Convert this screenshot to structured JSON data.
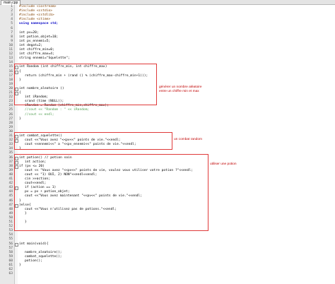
{
  "tab": {
    "label": "main.cpp"
  },
  "lines": [
    {
      "n": "1",
      "text": "#include <iostream>",
      "cls": "pp",
      "indent": 0
    },
    {
      "n": "2",
      "text": "#include <cstdio>",
      "cls": "pp",
      "indent": 0
    },
    {
      "n": "3",
      "text": "#include <cstdlib>",
      "cls": "pp",
      "indent": 0
    },
    {
      "n": "4",
      "text": "#include <ctime>",
      "cls": "pp",
      "indent": 0
    },
    {
      "n": "5",
      "text": "using namespace std;",
      "cls": "kw",
      "indent": 0
    },
    {
      "n": "6",
      "text": "",
      "cls": "",
      "indent": 0
    },
    {
      "n": "7",
      "text": "int pv=20;",
      "cls": "",
      "indent": 0
    },
    {
      "n": "8",
      "text": "int potion_objet=10;",
      "cls": "",
      "indent": 0
    },
    {
      "n": "9",
      "text": "int pv_ennemi=5;",
      "cls": "",
      "indent": 0
    },
    {
      "n": "10",
      "text": "int degat=2;",
      "cls": "",
      "indent": 0
    },
    {
      "n": "11",
      "text": "int chiffre_min=0;",
      "cls": "",
      "indent": 0
    },
    {
      "n": "12",
      "text": "int chiffre_max=4;",
      "cls": "",
      "indent": 0
    },
    {
      "n": "13",
      "text": "string ennemi=\"Squelette\";",
      "cls": "",
      "indent": 0
    },
    {
      "n": "14",
      "text": "",
      "cls": "",
      "indent": 0
    },
    {
      "n": "15",
      "text": "int Random (int chiffre_min, int chiffre_max)",
      "cls": "",
      "indent": 0
    },
    {
      "n": "16",
      "text": "{",
      "cls": "",
      "indent": 0
    },
    {
      "n": "17",
      "text": "return (chiffre_min + (rand () % (chiffre_max-chiffre_min+1)));",
      "cls": "",
      "indent": 1
    },
    {
      "n": "18",
      "text": "}",
      "cls": "",
      "indent": 0
    },
    {
      "n": "19",
      "text": "",
      "cls": "",
      "indent": 0
    },
    {
      "n": "20",
      "text": "int nombre_aleatoire ()",
      "cls": "",
      "indent": 0
    },
    {
      "n": "21",
      "text": "{",
      "cls": "",
      "indent": 0
    },
    {
      "n": "22",
      "text": "int iRandom;",
      "cls": "",
      "indent": 1
    },
    {
      "n": "23",
      "text": "srand (time (NULL));",
      "cls": "",
      "indent": 1
    },
    {
      "n": "24",
      "text": "iRandom = Random (chiffre_min,chiffre_max);",
      "cls": "",
      "indent": 1
    },
    {
      "n": "25",
      "text": "//cout << \"Random : \" << iRandom;",
      "cls": "cmt",
      "indent": 1
    },
    {
      "n": "26",
      "text": "//cout << endl;",
      "cls": "cmt",
      "indent": 1
    },
    {
      "n": "27",
      "text": "}",
      "cls": "",
      "indent": 0
    },
    {
      "n": "28",
      "text": "",
      "cls": "",
      "indent": 0
    },
    {
      "n": "29",
      "text": "",
      "cls": "",
      "indent": 0
    },
    {
      "n": "30",
      "text": "",
      "cls": "",
      "indent": 0
    },
    {
      "n": "31",
      "text": "int combat_squelette()",
      "cls": "",
      "indent": 0
    },
    {
      "n": "32",
      "text": "cout <<\"Vous avez \"<<pv<<\" points de vie.\"<<endl;",
      "cls": "",
      "indent": 1
    },
    {
      "n": "33",
      "text": "cout <<ennemi<<\" a \"<<pv_ennemi<<\" points de vie.\"<<endl;",
      "cls": "",
      "indent": 1
    },
    {
      "n": "34",
      "text": "}",
      "cls": "",
      "indent": 0
    },
    {
      "n": "35",
      "text": "",
      "cls": "",
      "indent": 0
    },
    {
      "n": "36",
      "text": "int potion() // potion soin",
      "cls": "",
      "indent": 0
    },
    {
      "n": "37",
      "text": "int action;",
      "cls": "",
      "indent": 1
    },
    {
      "n": "38",
      "text": "if (pv <= 20)",
      "cls": "",
      "indent": 0
    },
    {
      "n": "39",
      "text": "cout << \"Vous avez \"<<pv<<\" points de vie, voulez vous utiliser votre potion ?\"<<endl;",
      "cls": "",
      "indent": 1
    },
    {
      "n": "40",
      "text": "cout << \"1) OUI, 2) NON\"<<endl<<endl;",
      "cls": "",
      "indent": 1
    },
    {
      "n": "41",
      "text": "cin >>action;",
      "cls": "",
      "indent": 1
    },
    {
      "n": "42",
      "text": "cout<<endl;",
      "cls": "",
      "indent": 1
    },
    {
      "n": "43",
      "text": "if (action == 1)",
      "cls": "",
      "indent": 1
    },
    {
      "n": "44",
      "text": "pv = pv + potion_objet;",
      "cls": "",
      "indent": 1
    },
    {
      "n": "45",
      "text": "cout <<\"Vous avez maintenant \"<<pv<<\" points de vie.\"<<endl;",
      "cls": "",
      "indent": 1
    },
    {
      "n": "46",
      "text": "}",
      "cls": "",
      "indent": 0
    },
    {
      "n": "47",
      "text": "}else{",
      "cls": "",
      "indent": 0
    },
    {
      "n": "48",
      "text": "cout <<\"Vous n'utilisez pas de potions.\"<<endl;",
      "cls": "",
      "indent": 1
    },
    {
      "n": "49",
      "text": "}",
      "cls": "",
      "indent": 1
    },
    {
      "n": "50",
      "text": "",
      "cls": "",
      "indent": 0
    },
    {
      "n": "51",
      "text": "}",
      "cls": "",
      "indent": 1
    },
    {
      "n": "52",
      "text": "",
      "cls": "",
      "indent": 0
    },
    {
      "n": "53",
      "text": "",
      "cls": "",
      "indent": 0
    },
    {
      "n": "54",
      "text": "",
      "cls": "",
      "indent": 0
    },
    {
      "n": "55",
      "text": "",
      "cls": "",
      "indent": 0
    },
    {
      "n": "56",
      "text": "int main(void){",
      "cls": "",
      "indent": 0
    },
    {
      "n": "57",
      "text": "",
      "cls": "",
      "indent": 0
    },
    {
      "n": "58",
      "text": "nombre_aleatoire();",
      "cls": "",
      "indent": 1
    },
    {
      "n": "59",
      "text": "combat_squelette();",
      "cls": "",
      "indent": 1
    },
    {
      "n": "60",
      "text": "potion();",
      "cls": "",
      "indent": 1
    },
    {
      "n": "61",
      "text": "}",
      "cls": "",
      "indent": 0
    },
    {
      "n": "62",
      "text": "",
      "cls": "",
      "indent": 0
    },
    {
      "n": "63",
      "text": "",
      "cls": "",
      "indent": 0
    }
  ],
  "annotations": [
    {
      "id": "random",
      "text": "générer un nombre aléatoire\nentre un chiffre min et max"
    },
    {
      "id": "combat",
      "text": "un combat random"
    },
    {
      "id": "potion",
      "text": "utiliser une potion"
    }
  ]
}
